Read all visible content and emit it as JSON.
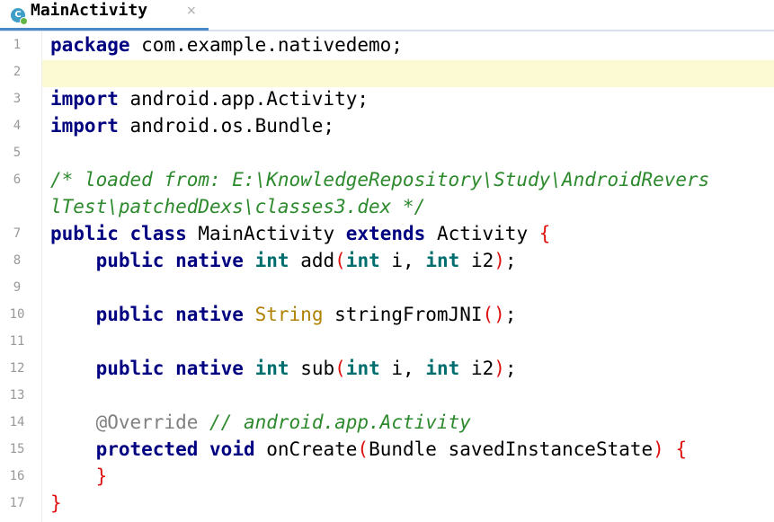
{
  "tab": {
    "title": "MainActivity",
    "icon_letter": "C",
    "close": "×"
  },
  "line_numbers": [
    "1",
    "2",
    "3",
    "4",
    "5",
    "6",
    "7",
    "8",
    "9",
    "10",
    "11",
    "12",
    "13",
    "14",
    "15",
    "16",
    "17"
  ],
  "code": {
    "l1": {
      "kw": "package",
      "rest": " com.example.nativedemo;"
    },
    "l3": {
      "kw": "import",
      "rest": " android.app.Activity;"
    },
    "l4": {
      "kw": "import",
      "rest": " android.os.Bundle;"
    },
    "l6a": "/* loaded from: E:\\KnowledgeRepository\\Study\\AndroidRevers",
    "l6b": "lTest\\patchedDexs\\classes3.dex */",
    "l7": {
      "kw1": "public",
      "kw2": "class",
      "name": "MainActivity",
      "kw3": "extends",
      "parent": "Activity",
      "brace": "{"
    },
    "l8": {
      "kw1": "public",
      "kw2": "native",
      "type": "int",
      "name": "add",
      "p1t": "int",
      "p1": "i,",
      "p2t": "int",
      "p2": "i2",
      "end": ";"
    },
    "l10": {
      "kw1": "public",
      "kw2": "native",
      "type": "String",
      "name": "stringFromJNI",
      "end": ";"
    },
    "l12": {
      "kw1": "public",
      "kw2": "native",
      "type": "int",
      "name": "sub",
      "p1t": "int",
      "p1": "i,",
      "p2t": "int",
      "p2": "i2",
      "end": ";"
    },
    "l14": {
      "ann": "@Override",
      "comment": "// android.app.Activity"
    },
    "l15": {
      "kw1": "protected",
      "kw2": "void",
      "name": "onCreate",
      "ptype": "Bundle",
      "pname": "savedInstanceState",
      "brace": "{"
    },
    "l16": {
      "brace": "}"
    },
    "l17": {
      "brace": "}"
    }
  },
  "colors": {
    "keyword": "#000080",
    "type": "#b08000",
    "comment": "#2c8a2c",
    "annotation": "#808080",
    "brace": "#e01010",
    "caret_row": "#fcfad3",
    "tab_underline": "#4a88c7"
  }
}
